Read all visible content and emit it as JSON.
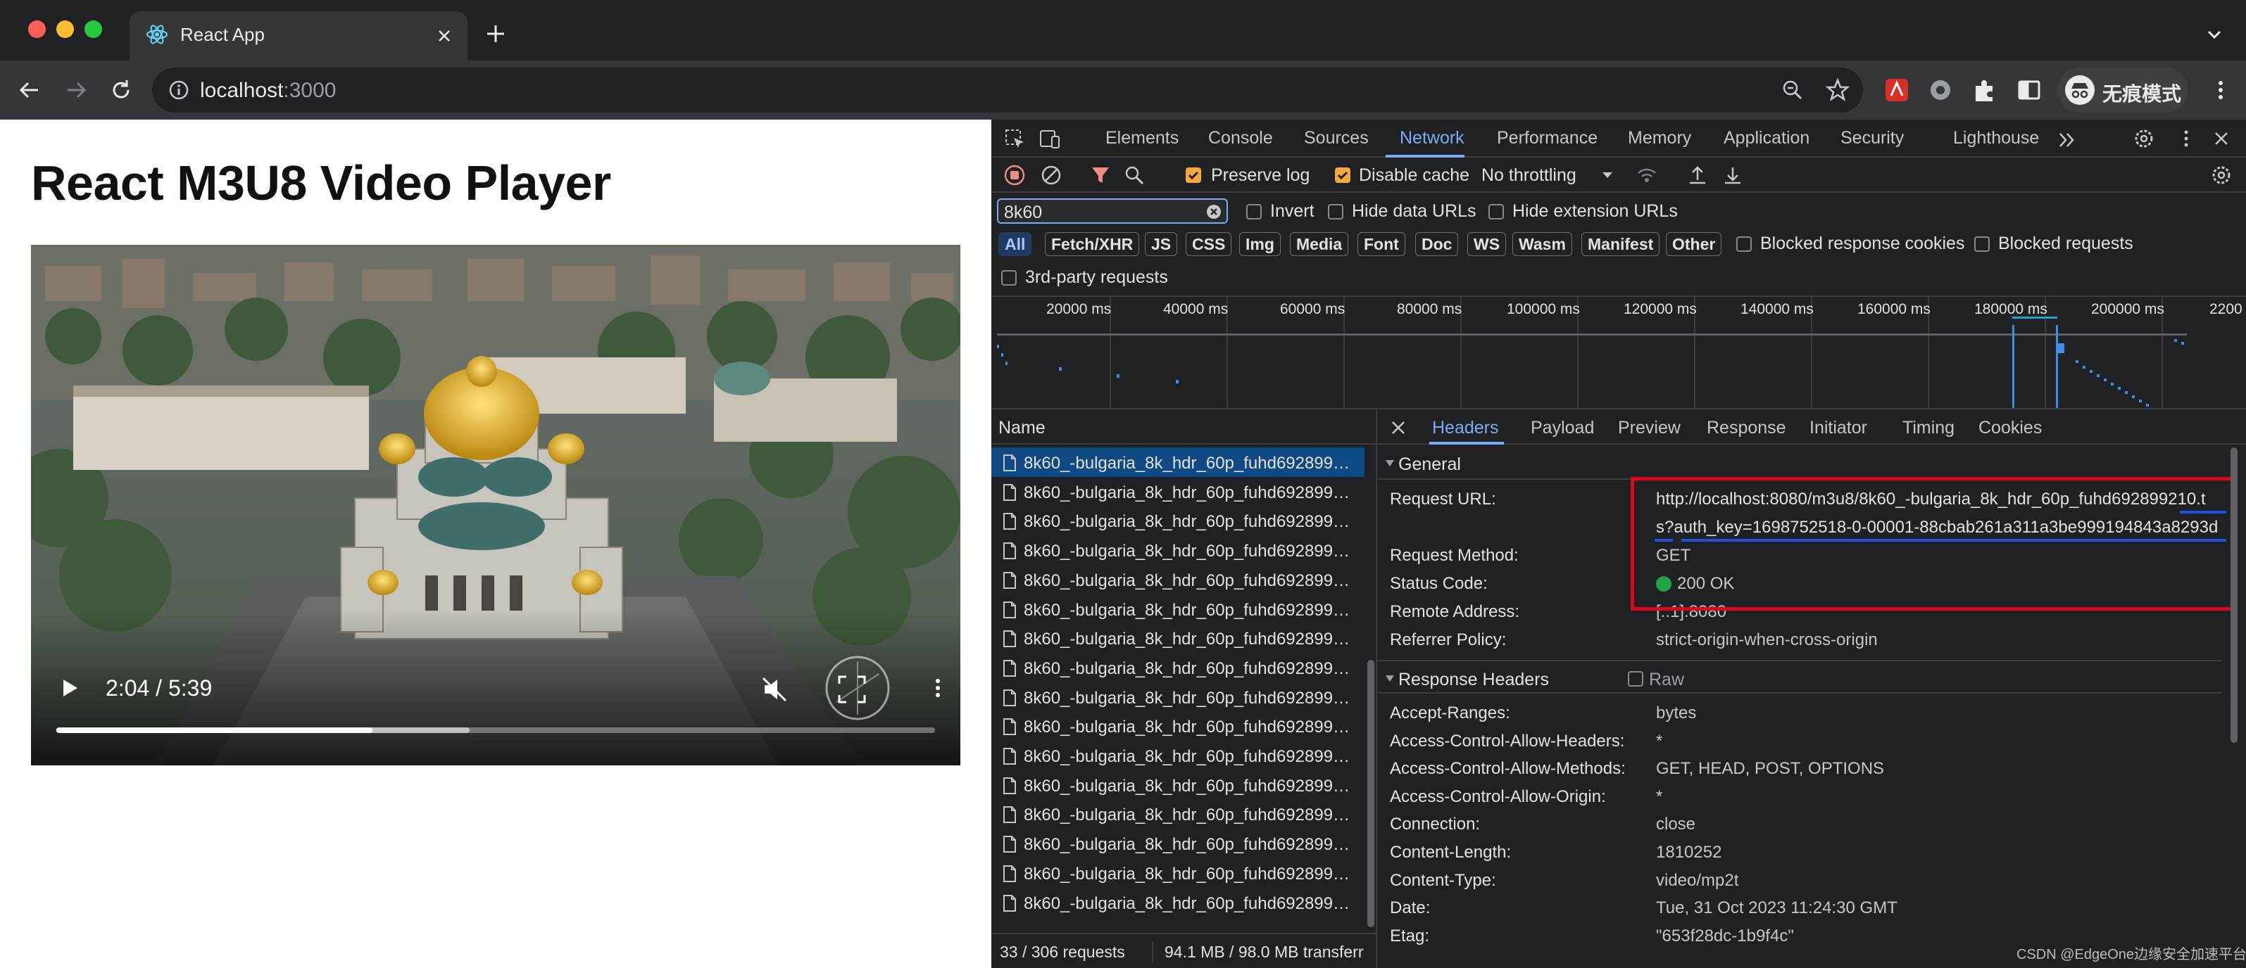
{
  "browser": {
    "tab_title": "React App",
    "url_host": "localhost",
    "url_port": ":3000",
    "incognito_label": "无痕模式"
  },
  "page": {
    "title": "React M3U8 Video Player",
    "video": {
      "time": "2:04 / 5:39",
      "played_fraction": 0.36,
      "buffered_fraction": 0.47,
      "muted": true
    }
  },
  "devtools": {
    "tabs": [
      "Elements",
      "Console",
      "Sources",
      "Network",
      "Performance",
      "Memory",
      "Application",
      "Security",
      "Lighthouse"
    ],
    "active_tab": "Network",
    "toolbar": {
      "preserve_log": "Preserve log",
      "disable_cache": "Disable cache",
      "throttling": "No throttling"
    },
    "filter": {
      "value": "8k60",
      "invert": "Invert",
      "hide_data_urls": "Hide data URLs",
      "hide_extension_urls": "Hide extension URLs",
      "type_pills": [
        "All",
        "Fetch/XHR",
        "JS",
        "CSS",
        "Img",
        "Media",
        "Font",
        "Doc",
        "WS",
        "Wasm",
        "Manifest",
        "Other"
      ],
      "blocked_cookies": "Blocked response cookies",
      "blocked_requests": "Blocked requests",
      "third_party": "3rd-party requests"
    },
    "overview_ticks": [
      "20000 ms",
      "40000 ms",
      "60000 ms",
      "80000 ms",
      "100000 ms",
      "120000 ms",
      "140000 ms",
      "160000 ms",
      "180000 ms",
      "200000 ms",
      "2200"
    ],
    "request_list": {
      "header": "Name",
      "rows": [
        "8k60_-bulgaria_8k_hdr_60p_fuhd692899…",
        "8k60_-bulgaria_8k_hdr_60p_fuhd692899…",
        "8k60_-bulgaria_8k_hdr_60p_fuhd692899…",
        "8k60_-bulgaria_8k_hdr_60p_fuhd692899…",
        "8k60_-bulgaria_8k_hdr_60p_fuhd692899…",
        "8k60_-bulgaria_8k_hdr_60p_fuhd692899…",
        "8k60_-bulgaria_8k_hdr_60p_fuhd692899…",
        "8k60_-bulgaria_8k_hdr_60p_fuhd692899…",
        "8k60_-bulgaria_8k_hdr_60p_fuhd692899…",
        "8k60_-bulgaria_8k_hdr_60p_fuhd692899…",
        "8k60_-bulgaria_8k_hdr_60p_fuhd692899…",
        "8k60_-bulgaria_8k_hdr_60p_fuhd692899…",
        "8k60_-bulgaria_8k_hdr_60p_fuhd692899…",
        "8k60_-bulgaria_8k_hdr_60p_fuhd692899…",
        "8k60_-bulgaria_8k_hdr_60p_fuhd692899…",
        "8k60_-bulgaria_8k_hdr_60p_fuhd692899…"
      ],
      "status": "33 / 306 requests",
      "transfer": "94.1 MB / 98.0 MB transferr"
    },
    "details": {
      "tabs": [
        "Headers",
        "Payload",
        "Preview",
        "Response",
        "Initiator",
        "Timing",
        "Cookies"
      ],
      "general_title": "General",
      "general": [
        {
          "k": "Request URL:",
          "v": "http://localhost:8080/m3u8/8k60_-bulgaria_8k_hdr_60p_fuhd692899210.t"
        },
        {
          "k": "",
          "v": "s?auth_key=1698752518-0-00001-88cbab261a311a3be999194843a8293d"
        },
        {
          "k": "Request Method:",
          "v": "GET"
        },
        {
          "k": "Status Code:",
          "v": "200 OK"
        },
        {
          "k": "Remote Address:",
          "v": "[::1]:8080"
        },
        {
          "k": "Referrer Policy:",
          "v": "strict-origin-when-cross-origin"
        }
      ],
      "response_title": "Response Headers",
      "raw_label": "Raw",
      "response": [
        {
          "k": "Accept-Ranges:",
          "v": "bytes"
        },
        {
          "k": "Access-Control-Allow-Headers:",
          "v": "*"
        },
        {
          "k": "Access-Control-Allow-Methods:",
          "v": "GET, HEAD, POST, OPTIONS"
        },
        {
          "k": "Access-Control-Allow-Origin:",
          "v": "*"
        },
        {
          "k": "Connection:",
          "v": "close"
        },
        {
          "k": "Content-Length:",
          "v": "1810252"
        },
        {
          "k": "Content-Type:",
          "v": "video/mp2t"
        },
        {
          "k": "Date:",
          "v": "Tue, 31 Oct 2023 11:24:30 GMT"
        },
        {
          "k": "Etag:",
          "v": "\"653f28dc-1b9f4c\""
        }
      ]
    }
  },
  "watermark": "CSDN @EdgeOne边缘安全加速平台",
  "colors": {
    "accent": "#7cacf8",
    "annotation_red": "#e0061d",
    "annotation_blue": "#1a4fe0",
    "checkbox_on": "#f2a83b",
    "status_ok": "#1ea446"
  }
}
